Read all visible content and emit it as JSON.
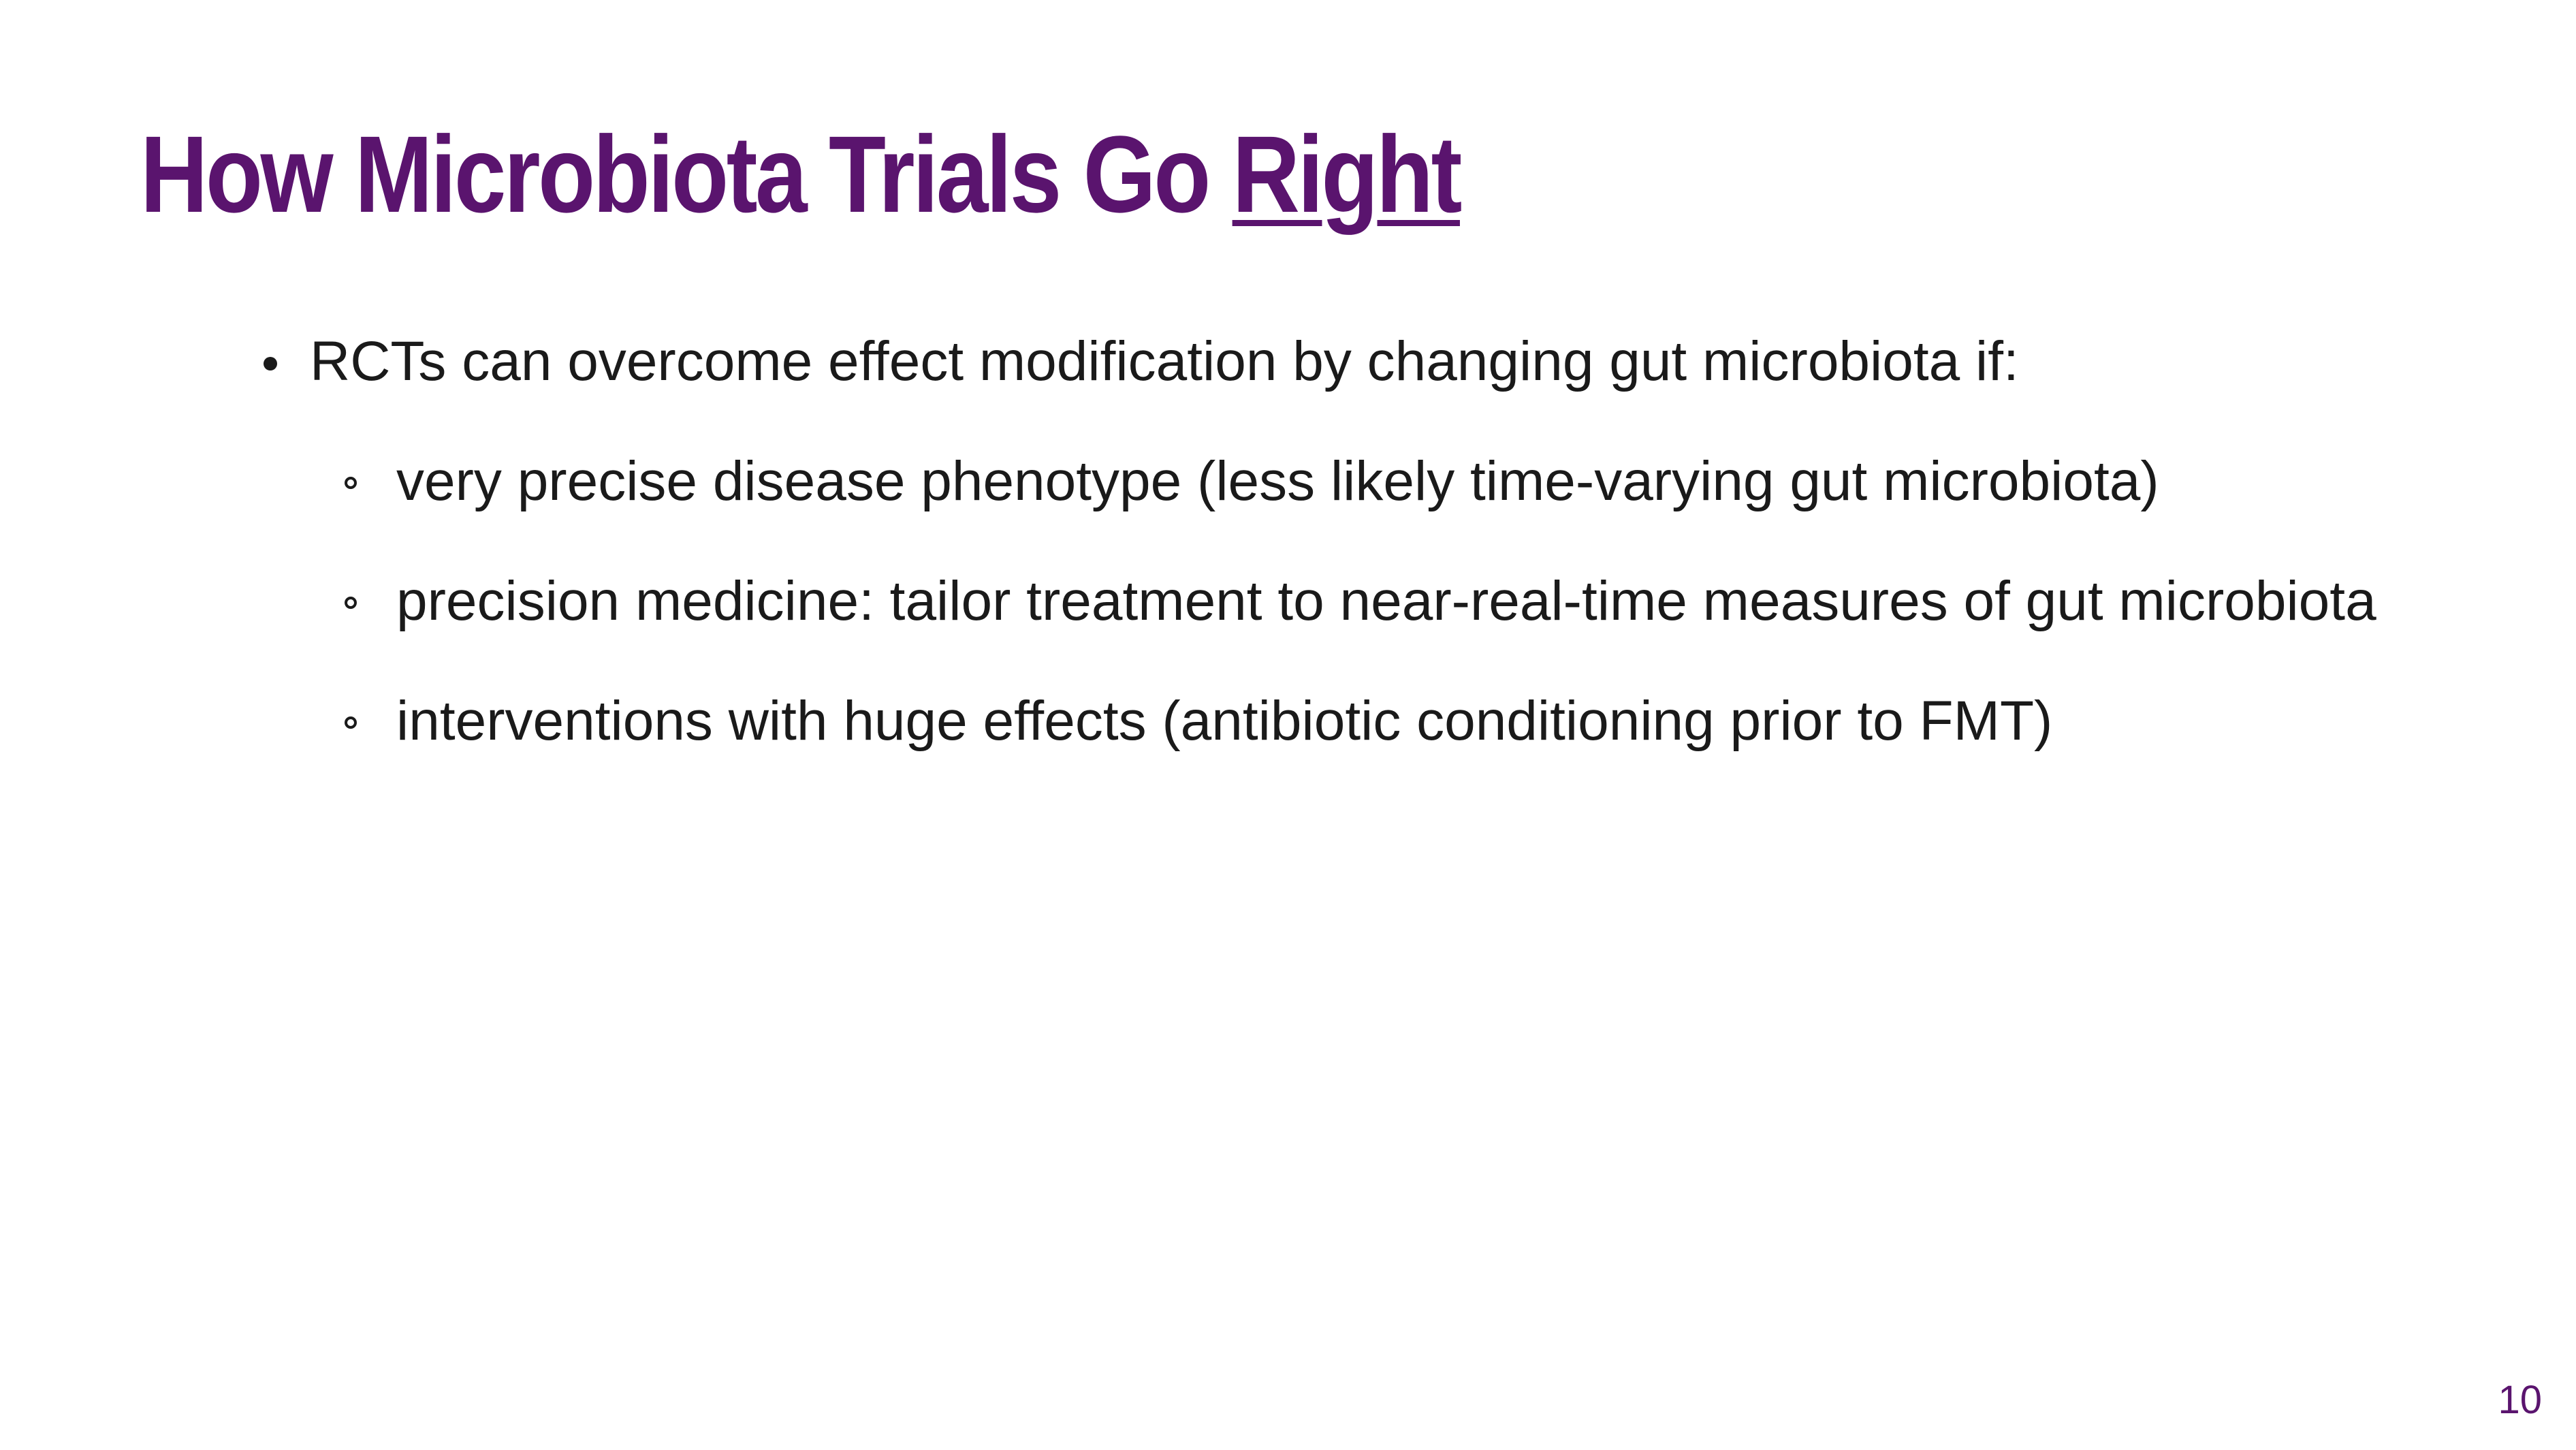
{
  "slide": {
    "title_main": "How Microbiota Trials Go ",
    "title_emphasis": "Right",
    "bullets": [
      {
        "text": "RCTs can overcome effect modification by changing gut microbiota if:",
        "sub_bullets": [
          "very precise disease phenotype (less likely time-varying gut microbiota)",
          "precision medicine: tailor treatment to near-real-time measures of gut microbiota",
          "interventions with huge effects (antibiotic conditioning prior to FMT)"
        ]
      }
    ],
    "page_number": "10",
    "colors": {
      "title": "#5a146e",
      "body_text": "#1a1a1a",
      "background": "#ffffff"
    }
  }
}
